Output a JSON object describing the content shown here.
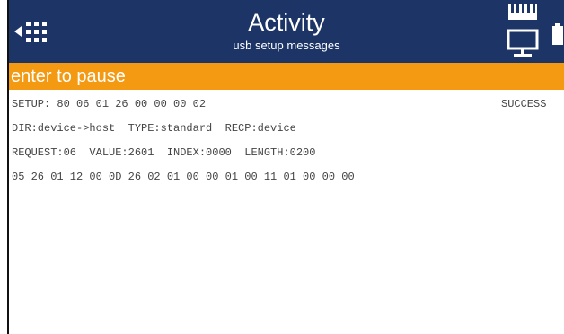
{
  "header": {
    "title": "Activity",
    "subtitle": "usb setup messages",
    "menu_icon": "back-grid-icon",
    "usb_icon": "usb-monitor-icon",
    "battery_icon": "battery-icon"
  },
  "pause_bar": {
    "label": "enter to pause"
  },
  "messages": {
    "status": "SUCCESS",
    "lines": [
      "SETUP: 80 06 01 26 00 00 00 02",
      "DIR:device->host  TYPE:standard  RECP:device",
      "REQUEST:06  VALUE:2601  INDEX:0000  LENGTH:0200",
      "05 26 01 12 00 0D 26 02 01 00 00 01 00 11 01 00 00 00"
    ]
  },
  "colors": {
    "header_bg": "#1d3566",
    "pause_bar_bg": "#f39a12",
    "text": "#444444"
  }
}
